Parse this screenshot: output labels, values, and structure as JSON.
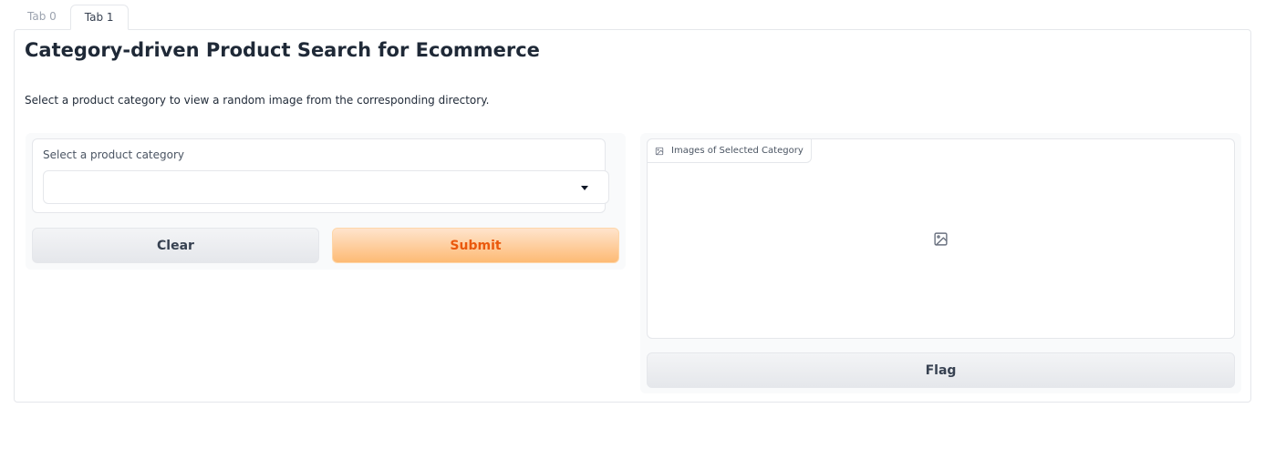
{
  "tabs": [
    {
      "label": "Tab 0",
      "active": false
    },
    {
      "label": "Tab 1",
      "active": true
    }
  ],
  "header": {
    "title": "Category-driven Product Search for Ecommerce",
    "description": "Select a product category to view a random image from the corresponding directory."
  },
  "left_panel": {
    "dropdown": {
      "label": "Select a product category",
      "value": "",
      "icon": "chevron-down-icon"
    },
    "clear_label": "Clear",
    "submit_label": "Submit"
  },
  "right_panel": {
    "image_label": "Images of Selected Category",
    "image_label_icon": "image-icon",
    "placeholder_icon": "image-placeholder-icon",
    "flag_label": "Flag"
  },
  "colors": {
    "accent": "#ea580c",
    "accent_bg": "#fdba74",
    "border": "#e5e7eb",
    "panel_bg": "#f9fafb"
  }
}
